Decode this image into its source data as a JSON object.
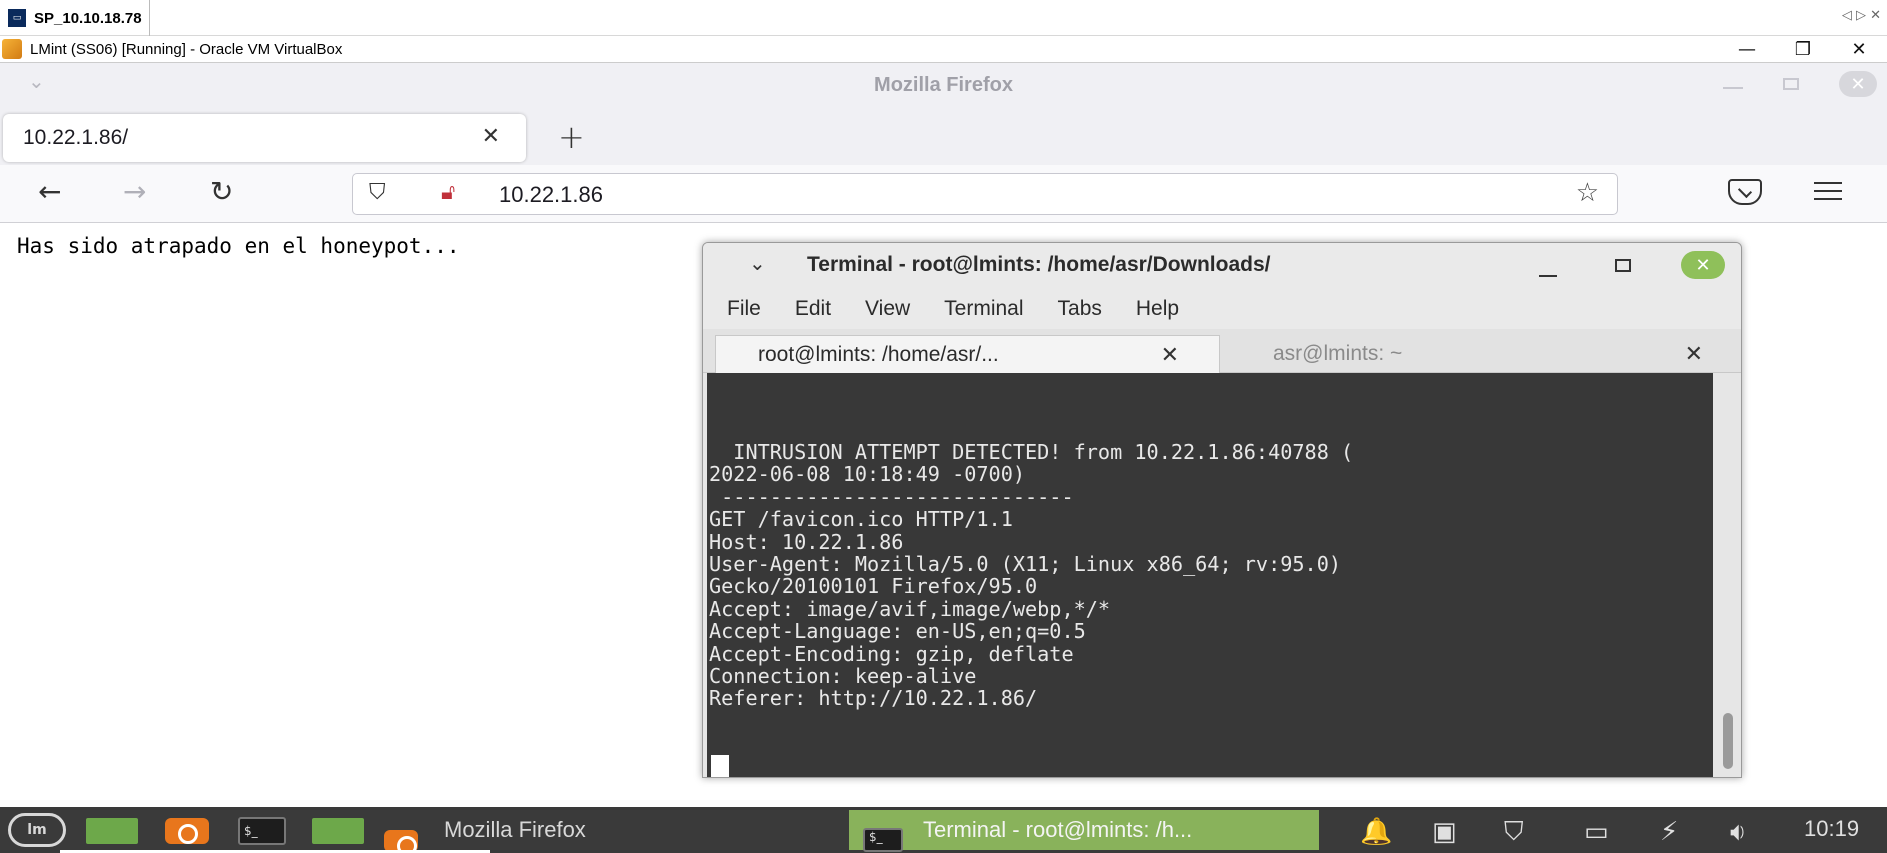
{
  "rdp": {
    "tab_title": "SP_10.10.18.78",
    "nav_glyphs": "◁ ▷ ✕"
  },
  "vbox": {
    "title": "LMint (SS06) [Running] - Oracle VM VirtualBox",
    "min": "—",
    "max": "❐",
    "close": "✕"
  },
  "firefox": {
    "window_title": "Mozilla Firefox",
    "tab_label": "10.22.1.86/",
    "url": "10.22.1.86",
    "page_text": "Has sido atrapado en el honeypot..."
  },
  "terminal": {
    "title": "Terminal - root@lmints: /home/asr/Downloads/",
    "menu": [
      "File",
      "Edit",
      "View",
      "Terminal",
      "Tabs",
      "Help"
    ],
    "tabs": [
      {
        "label": "root@lmints: /home/asr/...",
        "active": true
      },
      {
        "label": "asr@lmints: ~",
        "active": false
      }
    ],
    "lines": [
      "  INTRUSION ATTEMPT DETECTED! from 10.22.1.86:40788 (",
      "2022-06-08 10:18:49 -0700)",
      " -----------------------------",
      "GET /favicon.ico HTTP/1.1",
      "Host: 10.22.1.86",
      "User-Agent: Mozilla/5.0 (X11; Linux x86_64; rv:95.0)",
      "Gecko/20100101 Firefox/95.0",
      "Accept: image/avif,image/webp,*/*",
      "Accept-Language: en-US,en;q=0.5",
      "Accept-Encoding: gzip, deflate",
      "Connection: keep-alive",
      "Referer: http://10.22.1.86/"
    ],
    "scroll_position": 0.9
  },
  "taskbar": {
    "firefox_label": "Mozilla Firefox",
    "terminal_label": "Terminal - root@lmints: /h...",
    "clock": "10:19",
    "terminal_icon_text": "$_"
  },
  "icons": {
    "close": "✕",
    "plus": "+",
    "back": "←",
    "forward": "→",
    "reload": "↻",
    "star": "☆",
    "chevron": "⌄",
    "bell": "🔔",
    "shield": "⛉"
  }
}
